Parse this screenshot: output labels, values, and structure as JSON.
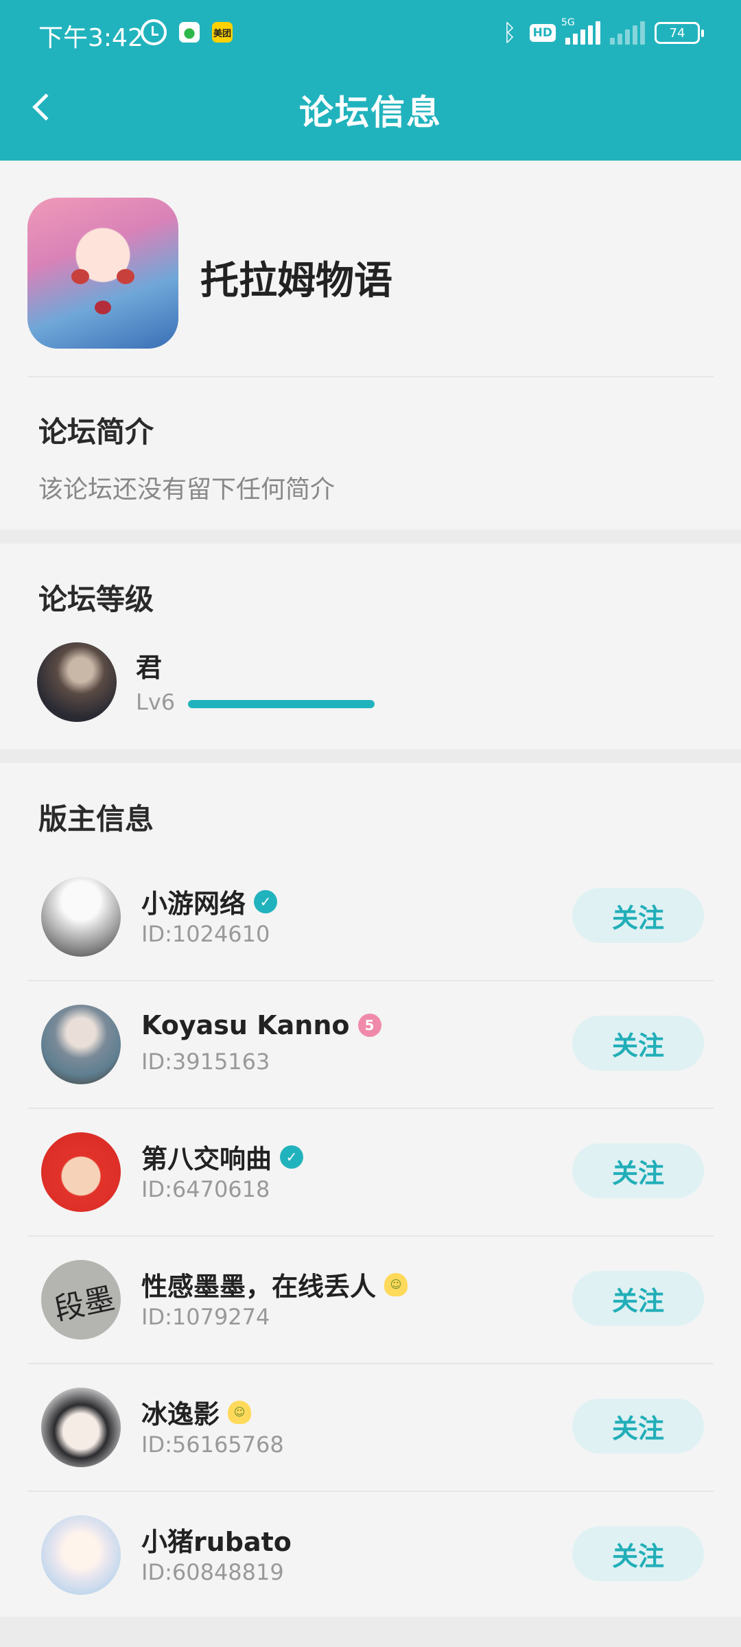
{
  "status_bar": {
    "time": "下午3:42",
    "network": "5G",
    "hd": "HD",
    "battery": "74",
    "apps": [
      "wechat",
      "美团"
    ]
  },
  "header": {
    "title": "论坛信息",
    "back_icon": "chevron-left-icon"
  },
  "forum": {
    "name": "托拉姆物语",
    "intro_title": "论坛简介",
    "intro_text": "该论坛还没有留下任何简介"
  },
  "level": {
    "section_title": "论坛等级",
    "name": "君",
    "lv": "Lv6",
    "progress_percent": 100
  },
  "moderators": {
    "section_title": "版主信息",
    "follow_label": "关注",
    "items": [
      {
        "name": "小游网络",
        "id": "ID:1024610",
        "badge": "verified"
      },
      {
        "name": "Koyasu Kanno",
        "id": "ID:3915163",
        "badge": "level5"
      },
      {
        "name": "第八交响曲",
        "id": "ID:6470618",
        "badge": "verified"
      },
      {
        "name": "性感墨墨，在线丢人",
        "id": "ID:1079274",
        "badge": "emoji"
      },
      {
        "name": "冰逸影",
        "id": "ID:56165768",
        "badge": "emoji"
      },
      {
        "name": "小猪rubato",
        "id": "ID:60848819",
        "badge": ""
      }
    ]
  },
  "colors": {
    "accent": "#21b3bd",
    "follow_bg": "#dff1f3",
    "page_bg": "#f4f4f4"
  }
}
